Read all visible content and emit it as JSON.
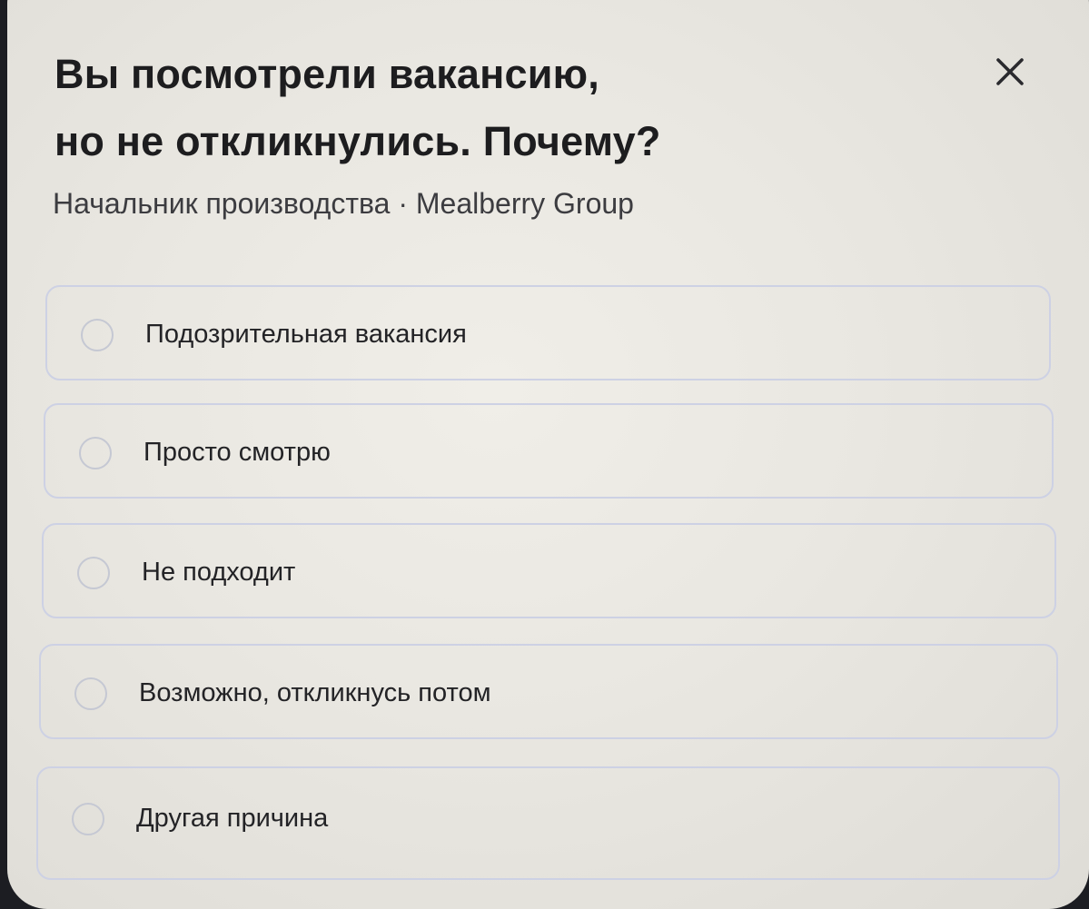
{
  "dialog": {
    "title_line1": "Вы посмотрели вакансию,",
    "title_line2": "но не откликнулись. Почему?",
    "subtitle": "Начальник производства · Mealberry Group",
    "close_icon": "close-icon"
  },
  "options": [
    {
      "label": "Подозрительная вакансия",
      "selected": false
    },
    {
      "label": "Просто смотрю",
      "selected": false
    },
    {
      "label": "Не подходит",
      "selected": false
    },
    {
      "label": "Возможно, откликнусь потом",
      "selected": false
    },
    {
      "label": "Другая причина",
      "selected": false
    }
  ],
  "colors": {
    "background": "#1c1d22",
    "modal": "#ebe9e3",
    "option_border": "#cdd1e4",
    "text": "#1d1d1f"
  }
}
